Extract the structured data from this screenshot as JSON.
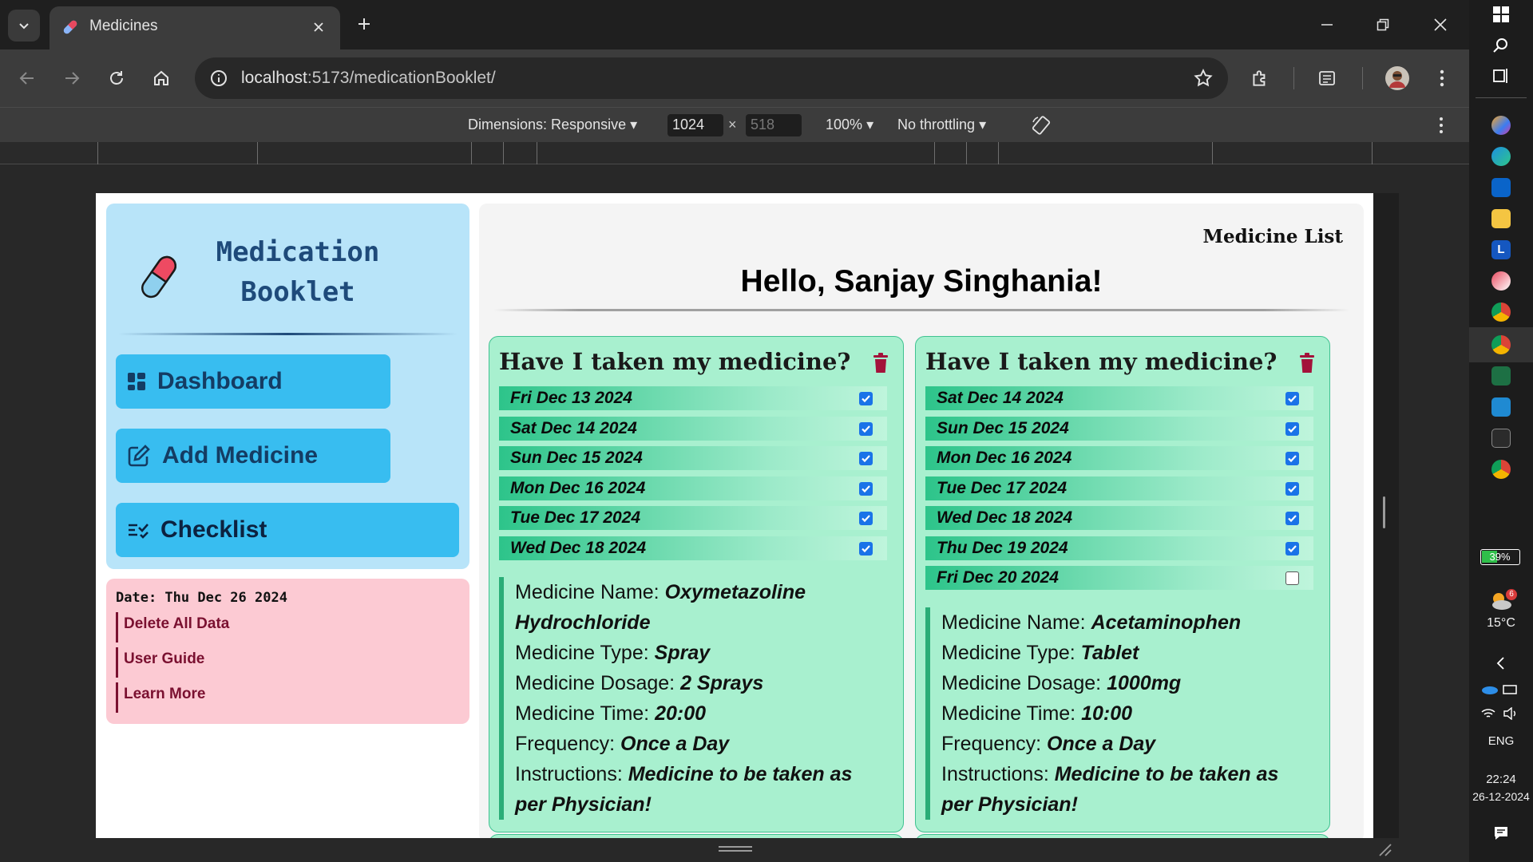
{
  "browser": {
    "tab_title": "Medicines",
    "url_host": "localhost",
    "url_path": ":5173/medicationBooklet/"
  },
  "devtools": {
    "dimensions_label": "Dimensions: Responsive",
    "width": "1024",
    "height": "518",
    "times": "×",
    "zoom": "100%",
    "throttling": "No throttling"
  },
  "sidebar": {
    "title_line1": "Medication",
    "title_line2": "Booklet",
    "nav": [
      {
        "label": "Dashboard",
        "icon": "dashboard-icon"
      },
      {
        "label": "Add Medicine",
        "icon": "edit-icon"
      },
      {
        "label": "Checklist",
        "icon": "checklist-icon"
      }
    ],
    "date_text": "Date: Thu Dec 26 2024",
    "links": [
      "Delete All Data",
      "User Guide",
      "Learn More"
    ]
  },
  "main": {
    "top_link": "Medicine List",
    "greeting": "Hello, Sanjay Singhania!",
    "cards": [
      {
        "title": "Have I taken my medicine?",
        "dates": [
          {
            "date": "Fri Dec 13 2024",
            "taken": true
          },
          {
            "date": "Sat Dec 14 2024",
            "taken": true
          },
          {
            "date": "Sun Dec 15 2024",
            "taken": true
          },
          {
            "date": "Mon Dec 16 2024",
            "taken": true
          },
          {
            "date": "Tue Dec 17 2024",
            "taken": true
          },
          {
            "date": "Wed Dec 18 2024",
            "taken": true
          }
        ],
        "details": {
          "name_label": "Medicine Name:",
          "name": "Oxymetazoline Hydrochloride",
          "type_label": "Medicine Type:",
          "type": "Spray",
          "dosage_label": "Medicine Dosage:",
          "dosage": "2 Sprays",
          "time_label": "Medicine Time:",
          "time": "20:00",
          "frequency_label": "Frequency:",
          "frequency": "Once a Day",
          "instructions_label": "Instructions:",
          "instructions": "Medicine to be taken as per Physician!"
        }
      },
      {
        "title": "Have I taken my medicine?",
        "dates": [
          {
            "date": "Sat Dec 14 2024",
            "taken": true
          },
          {
            "date": "Sun Dec 15 2024",
            "taken": true
          },
          {
            "date": "Mon Dec 16 2024",
            "taken": true
          },
          {
            "date": "Tue Dec 17 2024",
            "taken": true
          },
          {
            "date": "Wed Dec 18 2024",
            "taken": true
          },
          {
            "date": "Thu Dec 19 2024",
            "taken": true
          },
          {
            "date": "Fri Dec 20 2024",
            "taken": false
          }
        ],
        "details": {
          "name_label": "Medicine Name:",
          "name": "Acetaminophen",
          "type_label": "Medicine Type:",
          "type": "Tablet",
          "dosage_label": "Medicine Dosage:",
          "dosage": "1000mg",
          "time_label": "Medicine Time:",
          "time": "10:00",
          "frequency_label": "Frequency:",
          "frequency": "Once a Day",
          "instructions_label": "Instructions:",
          "instructions": "Medicine to be taken as per Physician!"
        }
      }
    ]
  },
  "taskbar": {
    "battery": "39%",
    "weather_temp": "15°C",
    "weather_badge": "6",
    "language": "ENG",
    "time": "22:24",
    "date": "26-12-2024"
  },
  "colors": {
    "sidebar_bg": "#b8e4f9",
    "nav_button": "#38bdf0",
    "info_bg": "#fccad3",
    "card_bg": "#a8f0cf",
    "checkbox": "#1a73e8",
    "trash": "#a3123a"
  }
}
